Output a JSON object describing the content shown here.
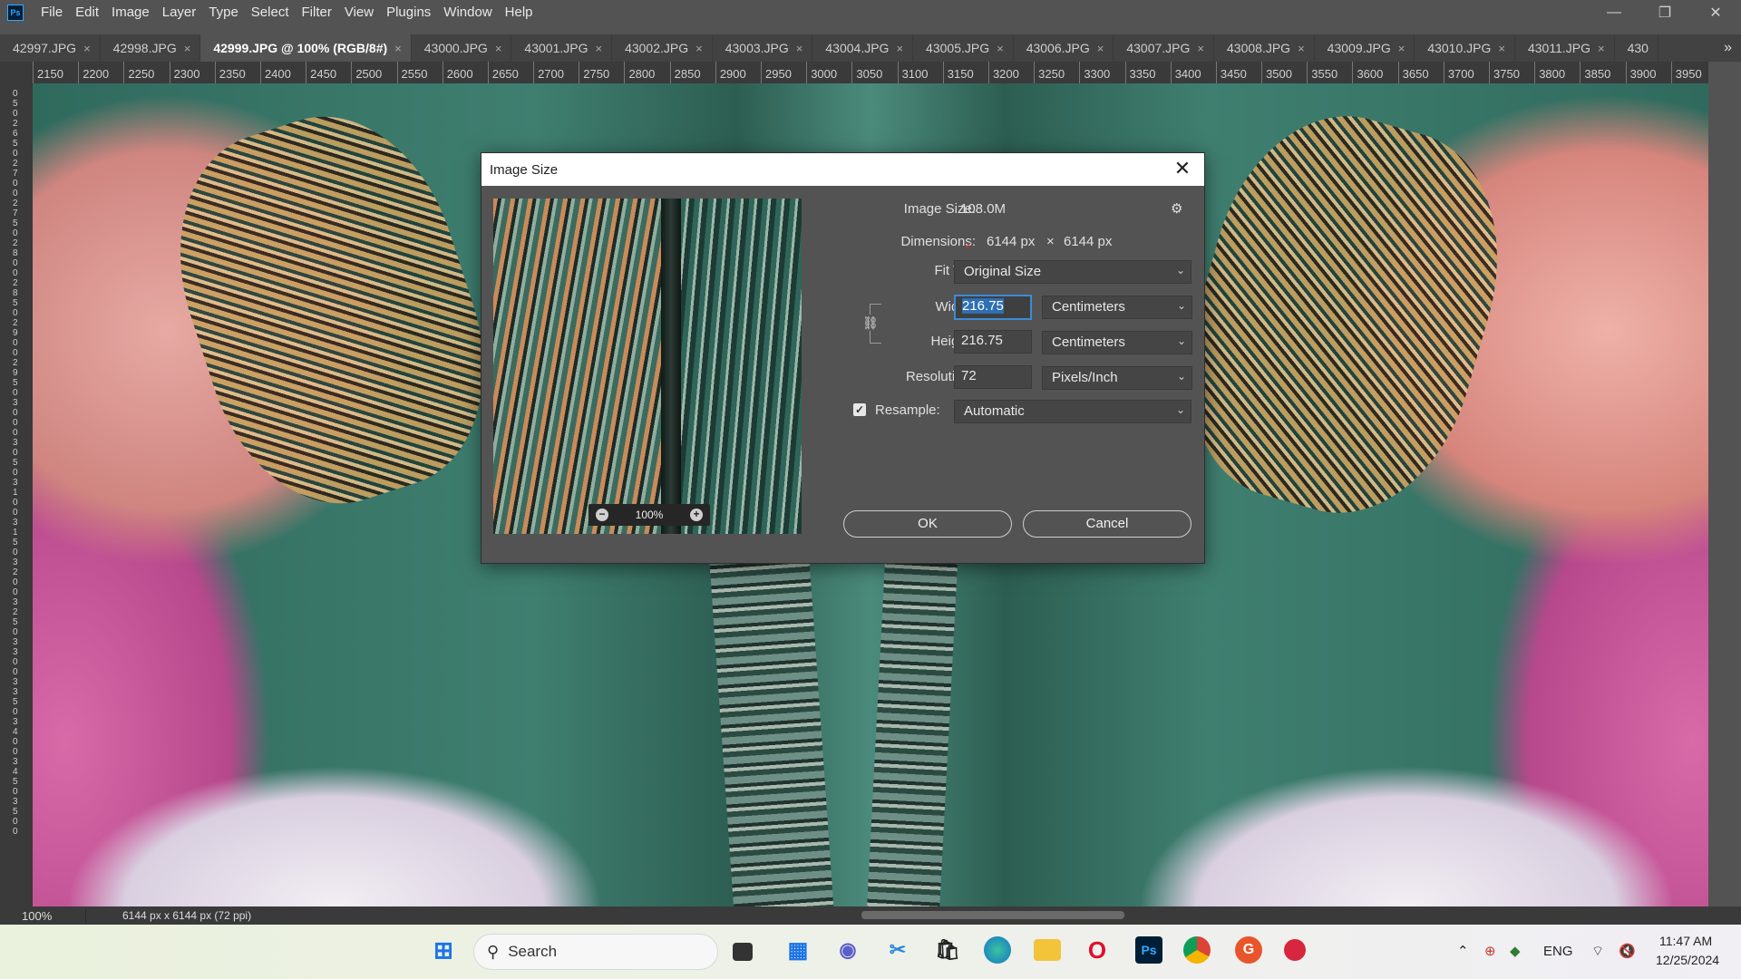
{
  "app": {
    "logo": "Ps"
  },
  "menu": [
    "File",
    "Edit",
    "Image",
    "Layer",
    "Type",
    "Select",
    "Filter",
    "View",
    "Plugins",
    "Window",
    "Help"
  ],
  "window_controls": {
    "minimize": "—",
    "maximize": "❐",
    "close": "✕"
  },
  "tabs": [
    {
      "label": "42997.JPG",
      "active": false
    },
    {
      "label": "42998.JPG",
      "active": false
    },
    {
      "label": "42999.JPG @ 100% (RGB/8#)",
      "active": true
    },
    {
      "label": "43000.JPG",
      "active": false
    },
    {
      "label": "43001.JPG",
      "active": false
    },
    {
      "label": "43002.JPG",
      "active": false
    },
    {
      "label": "43003.JPG",
      "active": false
    },
    {
      "label": "43004.JPG",
      "active": false
    },
    {
      "label": "43005.JPG",
      "active": false
    },
    {
      "label": "43006.JPG",
      "active": false
    },
    {
      "label": "43007.JPG",
      "active": false
    },
    {
      "label": "43008.JPG",
      "active": false
    },
    {
      "label": "43009.JPG",
      "active": false
    },
    {
      "label": "43010.JPG",
      "active": false
    },
    {
      "label": "43011.JPG",
      "active": false
    },
    {
      "label": "430",
      "active": false
    }
  ],
  "tab_close_glyph": "×",
  "tab_overflow": "»",
  "ruler_top": [
    "2150",
    "2200",
    "2250",
    "2300",
    "2350",
    "2400",
    "2450",
    "2500",
    "2550",
    "2600",
    "2650",
    "2700",
    "2750",
    "2800",
    "2850",
    "2900",
    "2950",
    "3000",
    "3050",
    "3100",
    "3150",
    "3200",
    "3250",
    "3300",
    "3350",
    "3400",
    "3450",
    "3500",
    "3550",
    "3600",
    "3650",
    "3700",
    "3750",
    "3800",
    "3850",
    "3900",
    "3950"
  ],
  "ruler_left_text": "0 5 0 2 6 5 0 2 7 0 0 2 7 5 0 2 8 0 0 2 8 5 0 2 9 0 0 2 9 5 0 3 0 0 0 3 0 5 0 3 1 0 0 3 1 5 0 3 2 0 0 3 2 5 0 3 3 0 0 3 3 5 0 3 4 0 0 3 4 5 0 3 5 0 0",
  "status": {
    "zoom": "100%",
    "doc_info": "6144 px x 6144 px (72 ppi)"
  },
  "dialog": {
    "title": "Image Size",
    "close_glyph": "✕",
    "preview_zoom": "100%",
    "image_size_label": "Image Size:",
    "image_size_value": "108.0M",
    "dimensions_label": "Dimensions:",
    "dimensions_width": "6144 px",
    "dimensions_x": "×",
    "dimensions_height": "6144 px",
    "fit_to_label": "Fit T...",
    "fit_to_value": "Original Size",
    "width_label": "Width:",
    "width_value": "216.75",
    "width_unit": "Centimeters",
    "height_label": "Height:",
    "height_value": "216.75",
    "height_unit": "Centimeters",
    "resolution_label": "Resolution:",
    "resolution_value": "72",
    "resolution_unit": "Pixels/Inch",
    "resample_label": "Resample:",
    "resample_checked": true,
    "resample_value": "Automatic",
    "ok_label": "OK",
    "cancel_label": "Cancel",
    "zoom_minus": "−",
    "zoom_plus": "+"
  },
  "taskbar": {
    "search_placeholder": "Search",
    "lang": "ENG",
    "time": "11:47 AM",
    "date": "12/25/2024",
    "ps_label": "Ps",
    "opera_label": "O",
    "g_label": "G"
  }
}
